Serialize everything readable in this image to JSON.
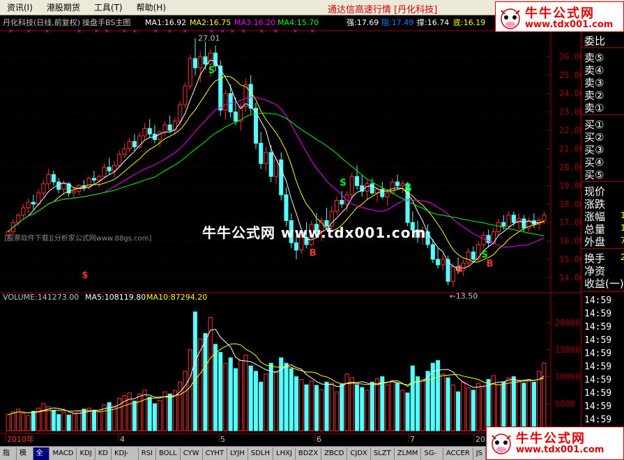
{
  "menu": {
    "items": [
      "资讯(I)",
      "港股期货",
      "工具(T)",
      "帮助(H)"
    ]
  },
  "app_title": "通达信高速行情 [丹化科技]",
  "logo": {
    "cn": "牛牛公式网",
    "url": "www.tdx001.com"
  },
  "chart_header": {
    "stock": "丹化科技(日线,前复权)",
    "indicator": "操盘手BS主图",
    "ma1": "MA1:16.92",
    "ma2": "MA2:16.75",
    "ma3": "MA3:16.20",
    "ma4": "MA4:15.70",
    "strong": "强:17.69",
    "resist": "阻:17.49",
    "support": "撑:16.74",
    "bottom": "底:16.19"
  },
  "price_axis": [
    "26.00",
    "25.00",
    "24.00",
    "23.00",
    "22.00",
    "21.00",
    "20.00",
    "19.00",
    "18.00",
    "17.00",
    "16.00",
    "15.00",
    "14.00"
  ],
  "annotations": {
    "high": "27.01",
    "low": "←13.50"
  },
  "volume_header": {
    "volume": "VOLUME:141273.00",
    "ma5": "MA5:108119.80",
    "ma10": "MA10:87294.20"
  },
  "volume_axis": [
    "20000",
    "15000",
    "10000",
    "5000"
  ],
  "x_axis": [
    "2010年",
    "4",
    "5",
    "6",
    "7",
    "20"
  ],
  "right_panel": {
    "labels": [
      "委比",
      "卖⑤",
      "卖④",
      "卖③",
      "卖②",
      "卖①",
      "买①",
      "买②",
      "买③",
      "买④",
      "买⑤",
      "现价",
      "涨跌",
      "涨幅",
      "总量",
      "外盘",
      "换手",
      "净资",
      "收益(一)"
    ],
    "values": [
      "1",
      "1",
      "7",
      "2"
    ],
    "times": [
      "14:59",
      "14:59",
      "14:59",
      "14:59",
      "14:59",
      "14:59",
      "14:59",
      "14:59",
      "14:59",
      "14:59"
    ]
  },
  "toolbar": [
    "指标",
    "模板",
    "全部",
    "MACD",
    "KDJ",
    "KD",
    "KDJ-TDX",
    "RSI",
    "BOLL",
    "CYW",
    "CYHT",
    "LYJH",
    "SDLH",
    "LHXJ",
    "BDZX",
    "ZBCD",
    "CJDX",
    "SLZT",
    "ZLMM",
    "SG-LB",
    "ACCER",
    "JS"
  ],
  "watermark": "牛牛公式网 www.tdx001.com",
  "watermark_small": "[股票软件下载][分析家公式网www.88gs.com]",
  "signals": [
    "S",
    "S",
    "S",
    "S",
    "B",
    "B",
    "B",
    "$"
  ],
  "colors": {
    "up": "#ff3232",
    "down": "#54ffff",
    "ma1": "#ffffff",
    "ma2": "#ffff00",
    "ma3": "#ff00ff",
    "ma4": "#00ff00",
    "grid": "#a00000"
  },
  "chart_data": {
    "type": "candlestick",
    "ylim": [
      13.3,
      27.3
    ],
    "volume_ylim": [
      0,
      24000
    ],
    "candles": [
      [
        16.3,
        16.6,
        16.0,
        16.5
      ],
      [
        16.5,
        17.2,
        16.3,
        17.0
      ],
      [
        17.0,
        17.5,
        16.8,
        17.4
      ],
      [
        17.4,
        18.0,
        17.2,
        17.8
      ],
      [
        17.8,
        18.3,
        17.5,
        18.1
      ],
      [
        18.1,
        18.5,
        17.7,
        18.0
      ],
      [
        18.0,
        18.8,
        17.9,
        18.6
      ],
      [
        18.6,
        19.3,
        18.4,
        19.1
      ],
      [
        19.1,
        19.9,
        18.8,
        19.6
      ],
      [
        19.6,
        19.8,
        19.0,
        19.2
      ],
      [
        19.2,
        19.4,
        18.6,
        18.8
      ],
      [
        18.8,
        19.3,
        18.5,
        19.1
      ],
      [
        19.1,
        19.2,
        18.4,
        18.6
      ],
      [
        18.6,
        18.9,
        18.3,
        18.7
      ],
      [
        18.7,
        19.1,
        18.5,
        19.0
      ],
      [
        19.0,
        19.3,
        18.7,
        18.9
      ],
      [
        18.9,
        19.5,
        18.8,
        19.4
      ],
      [
        19.4,
        19.8,
        19.1,
        19.3
      ],
      [
        19.3,
        19.6,
        18.9,
        19.5
      ],
      [
        19.5,
        20.2,
        19.4,
        20.0
      ],
      [
        20.0,
        20.5,
        19.6,
        19.8
      ],
      [
        19.8,
        20.3,
        19.5,
        20.1
      ],
      [
        20.1,
        20.9,
        20.0,
        20.7
      ],
      [
        20.7,
        21.3,
        20.5,
        21.0
      ],
      [
        21.0,
        21.6,
        20.8,
        21.4
      ],
      [
        21.4,
        21.8,
        20.9,
        21.1
      ],
      [
        21.1,
        21.9,
        21.0,
        21.7
      ],
      [
        21.7,
        22.4,
        21.5,
        22.1
      ],
      [
        22.1,
        22.6,
        21.6,
        21.8
      ],
      [
        21.8,
        22.3,
        21.3,
        21.5
      ],
      [
        21.5,
        22.0,
        21.1,
        21.9
      ],
      [
        21.9,
        22.5,
        21.7,
        22.3
      ],
      [
        22.3,
        22.8,
        21.9,
        22.0
      ],
      [
        22.0,
        22.7,
        21.8,
        22.5
      ],
      [
        22.5,
        23.6,
        22.3,
        23.4
      ],
      [
        23.4,
        24.6,
        23.2,
        24.4
      ],
      [
        24.4,
        26.1,
        24.2,
        25.9
      ],
      [
        25.9,
        27.0,
        25.0,
        25.4
      ],
      [
        25.4,
        26.3,
        24.6,
        26.0
      ],
      [
        26.0,
        26.8,
        25.3,
        25.6
      ],
      [
        25.6,
        26.4,
        24.9,
        26.2
      ],
      [
        26.2,
        26.6,
        25.2,
        25.5
      ],
      [
        25.5,
        25.8,
        22.8,
        23.1
      ],
      [
        23.1,
        24.2,
        22.6,
        24.0
      ],
      [
        24.0,
        24.5,
        22.7,
        23.0
      ],
      [
        23.0,
        23.8,
        22.3,
        22.5
      ],
      [
        22.5,
        23.5,
        22.0,
        23.3
      ],
      [
        23.3,
        24.8,
        23.0,
        24.5
      ],
      [
        24.5,
        25.0,
        22.9,
        23.2
      ],
      [
        23.2,
        23.5,
        21.0,
        21.3
      ],
      [
        21.3,
        21.9,
        19.9,
        20.2
      ],
      [
        20.2,
        21.1,
        19.8,
        20.8
      ],
      [
        20.8,
        21.2,
        19.2,
        19.5
      ],
      [
        19.5,
        20.6,
        19.1,
        20.4
      ],
      [
        20.4,
        20.8,
        18.2,
        18.5
      ],
      [
        18.5,
        18.9,
        16.8,
        17.1
      ],
      [
        17.1,
        17.5,
        15.6,
        15.9
      ],
      [
        15.9,
        16.3,
        15.0,
        15.5
      ],
      [
        15.5,
        16.5,
        15.3,
        16.2
      ],
      [
        16.2,
        17.0,
        15.6,
        15.8
      ],
      [
        15.8,
        17.1,
        15.7,
        16.9
      ],
      [
        16.9,
        17.5,
        16.3,
        16.5
      ],
      [
        16.5,
        17.3,
        16.0,
        17.1
      ],
      [
        17.1,
        17.8,
        16.6,
        16.8
      ],
      [
        16.8,
        17.9,
        16.6,
        17.6
      ],
      [
        17.6,
        18.4,
        17.4,
        18.2
      ],
      [
        18.2,
        18.7,
        17.8,
        18.0
      ],
      [
        18.0,
        18.7,
        17.6,
        18.5
      ],
      [
        18.5,
        19.7,
        18.3,
        19.5
      ],
      [
        19.5,
        20.1,
        18.8,
        19.0
      ],
      [
        19.0,
        19.6,
        18.4,
        18.7
      ],
      [
        18.7,
        19.3,
        18.2,
        19.1
      ],
      [
        19.1,
        19.4,
        18.5,
        18.6
      ],
      [
        18.6,
        18.9,
        18.1,
        18.8
      ],
      [
        18.8,
        19.2,
        18.3,
        18.4
      ],
      [
        18.4,
        18.8,
        17.9,
        18.6
      ],
      [
        18.6,
        19.4,
        18.5,
        19.2
      ],
      [
        19.2,
        19.6,
        18.8,
        19.0
      ],
      [
        19.0,
        19.3,
        18.6,
        19.1
      ],
      [
        19.1,
        19.2,
        16.8,
        17.0
      ],
      [
        17.0,
        17.6,
        16.4,
        16.6
      ],
      [
        16.6,
        17.1,
        15.9,
        16.2
      ],
      [
        16.2,
        16.8,
        15.8,
        16.5
      ],
      [
        16.5,
        16.9,
        15.6,
        15.8
      ],
      [
        15.8,
        16.1,
        14.8,
        15.0
      ],
      [
        15.0,
        15.6,
        14.5,
        14.7
      ],
      [
        14.7,
        15.3,
        14.4,
        15.0
      ],
      [
        15.0,
        15.2,
        13.6,
        13.8
      ],
      [
        13.8,
        14.8,
        13.5,
        14.6
      ],
      [
        14.6,
        15.1,
        14.2,
        14.4
      ],
      [
        14.4,
        15.0,
        14.1,
        14.8
      ],
      [
        14.8,
        15.6,
        14.6,
        15.4
      ],
      [
        15.4,
        15.7,
        14.8,
        15.0
      ],
      [
        15.0,
        16.0,
        14.9,
        15.8
      ],
      [
        15.8,
        16.5,
        15.6,
        16.3
      ],
      [
        16.3,
        16.6,
        15.7,
        15.9
      ],
      [
        15.9,
        16.7,
        15.8,
        16.5
      ],
      [
        16.5,
        17.2,
        16.3,
        17.0
      ],
      [
        17.0,
        17.4,
        16.6,
        16.8
      ],
      [
        16.8,
        17.6,
        16.7,
        17.4
      ],
      [
        17.4,
        17.6,
        16.8,
        17.0
      ],
      [
        17.0,
        17.5,
        16.6,
        17.2
      ],
      [
        17.2,
        17.4,
        16.5,
        16.7
      ],
      [
        16.7,
        17.3,
        16.5,
        17.1
      ],
      [
        17.1,
        17.5,
        16.7,
        16.9
      ],
      [
        16.9,
        17.3,
        16.6,
        17.1
      ],
      [
        17.1,
        17.6,
        16.9,
        17.4
      ]
    ],
    "volumes": [
      3000,
      3500,
      4000,
      3200,
      2800,
      3600,
      4200,
      5000,
      4500,
      3800,
      3000,
      3400,
      2900,
      3100,
      3600,
      4000,
      4200,
      3800,
      3500,
      4800,
      5200,
      4600,
      6000,
      6500,
      7000,
      5500,
      6800,
      7500,
      6200,
      5000,
      5600,
      7200,
      6800,
      7400,
      9000,
      11000,
      15000,
      22000,
      17000,
      18000,
      21000,
      16000,
      14500,
      12500,
      13500,
      11500,
      13000,
      14000,
      12000,
      11000,
      9000,
      10500,
      12500,
      11000,
      13500,
      12500,
      11500,
      10000,
      9500,
      8500,
      9200,
      8400,
      7600,
      9000,
      8800,
      7200,
      8600,
      10500,
      9800,
      8500,
      8000,
      7500,
      9000,
      9600,
      10000,
      8500,
      9200,
      8800,
      7500,
      7000,
      12000,
      10000,
      9500,
      11000,
      12500,
      13000,
      10500,
      9800,
      8500,
      7200,
      9000,
      8000,
      7500,
      8800,
      8000,
      9500,
      10200,
      8500,
      9000,
      9800,
      10000,
      9200,
      8800,
      9500,
      9000,
      11000,
      12500
    ]
  }
}
